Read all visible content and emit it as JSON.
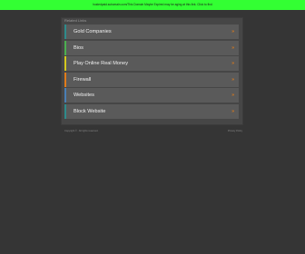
{
  "banner": {
    "text": "hostedpaid.subomain.com/This Domain Maybe Expired may be aging at this link. Click to find",
    "color": "#33ff33"
  },
  "related": {
    "label": "Related Links"
  },
  "links": [
    {
      "label": "Gold Companies",
      "arrow": "»",
      "accent": "#2e8b8b"
    },
    {
      "label": "Bios",
      "arrow": "»",
      "accent": "#4caf50"
    },
    {
      "label": "Play Online Real Money",
      "arrow": "»",
      "accent": "#d4c81e"
    },
    {
      "label": "Firewall",
      "arrow": "»",
      "accent": "#e07b1a"
    },
    {
      "label": "Websites",
      "arrow": "»",
      "accent": "#4a7fb5"
    },
    {
      "label": "Block Website",
      "arrow": "»",
      "accent": "#2e8b8b"
    }
  ],
  "footer": {
    "copyright": "Copyright © . All rights reserved.",
    "privacy": "Privacy Policy"
  }
}
